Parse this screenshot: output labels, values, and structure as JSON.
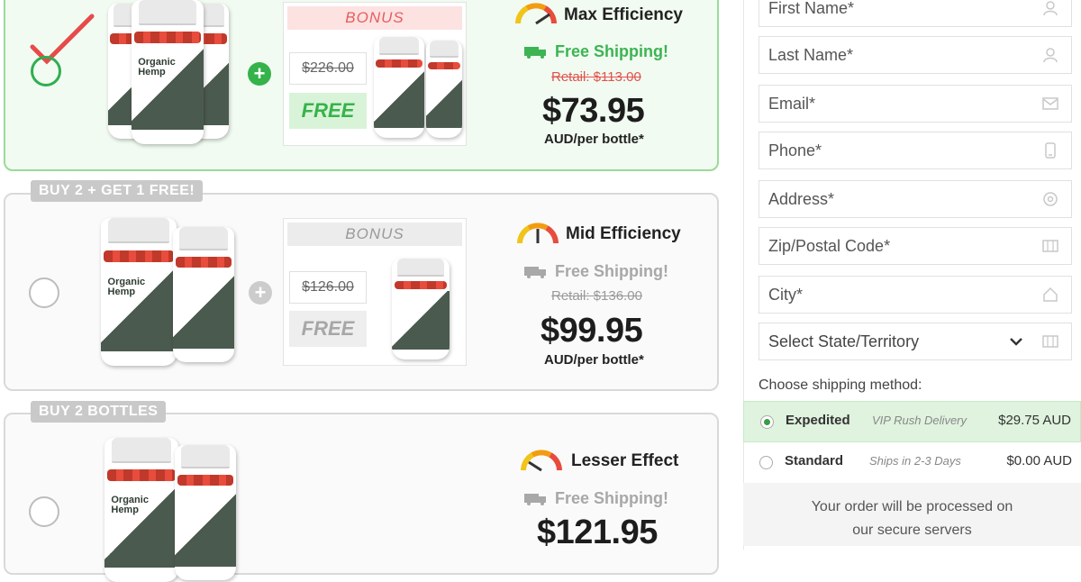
{
  "packages": [
    {
      "badge": "",
      "selected": true,
      "bottle_label": "Organic Hemp",
      "bonus_header": "BONUS",
      "bonus_old_price": "$226.00",
      "bonus_free": "FREE",
      "efficiency": "Max Efficiency",
      "shipping": "Free Shipping!",
      "retail": "Retail: $113.00",
      "price": "$73.95",
      "per_bottle": "AUD/per bottle*"
    },
    {
      "badge": "BUY 2 + GET 1 FREE!",
      "selected": false,
      "bottle_label": "Organic Hemp",
      "bonus_header": "BONUS",
      "bonus_old_price": "$126.00",
      "bonus_free": "FREE",
      "efficiency": "Mid Efficiency",
      "shipping": "Free Shipping!",
      "retail": "Retail: $136.00",
      "price": "$99.95",
      "per_bottle": "AUD/per bottle*"
    },
    {
      "badge": "BUY 2 BOTTLES",
      "selected": false,
      "bottle_label": "Organic Hemp",
      "efficiency": "Lesser Effect",
      "shipping": "Free Shipping!",
      "price": "$121.95"
    }
  ],
  "form": {
    "first_name": "First Name*",
    "last_name": "Last Name*",
    "email": "Email*",
    "phone": "Phone*",
    "address": "Address*",
    "zip": "Zip/Postal Code*",
    "city": "City*",
    "state": "Select State/Territory",
    "shipping_label": "Choose shipping method:",
    "shipping_options": [
      {
        "name": "Expedited",
        "note": "VIP Rush Delivery",
        "price": "$29.75 AUD",
        "selected": true
      },
      {
        "name": "Standard",
        "note": "Ships in 2-3 Days",
        "price": "$0.00 AUD",
        "selected": false
      }
    ],
    "secure_line1": "Your order will be processed on",
    "secure_line2": "our secure servers"
  },
  "colors": {
    "accent_green": "#35b24a",
    "retail_red": "#e2524d",
    "selected_bg": "#f1fbf1",
    "badge_grey": "#c9c9c9"
  }
}
